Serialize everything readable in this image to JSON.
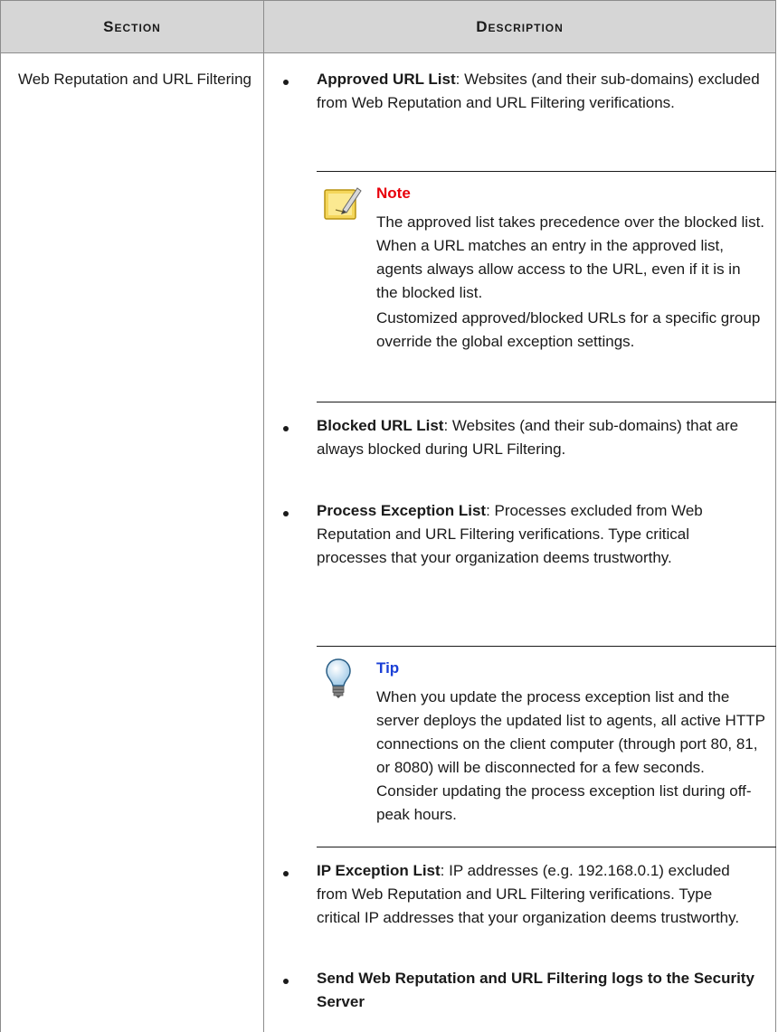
{
  "table": {
    "headers": {
      "section": "Section",
      "description": "Description"
    },
    "section_name": "Web Reputation and URL Filtering",
    "items": [
      {
        "term": "Approved URL List",
        "text": ": Websites (and their sub-domains) excluded from Web Reputation and URL Filtering verifications."
      },
      {
        "term": "Blocked URL List",
        "text": ": Websites (and their sub-domains) that are always blocked during URL Filtering."
      },
      {
        "term": "Process Exception List",
        "text": ": Processes excluded from Web Reputation and URL Filtering verifications. Type critical processes that your organization deems trustworthy."
      },
      {
        "term": "IP Exception List",
        "text": ": IP addresses (e.g. 192.168.0.1) excluded from Web Reputation and URL Filtering verifications. Type critical IP addresses that your organization deems trustworthy."
      },
      {
        "term": "Send Web Reputation and URL Filtering logs to the Security Server",
        "text": ""
      }
    ],
    "note": {
      "title": "Note",
      "color": "#e8000b",
      "paragraphs": [
        "The approved list takes precedence over the blocked list. When a URL matches an entry in the approved list, agents always allow access to the URL, even if it is in the blocked list.",
        "Customized approved/blocked URLs for a specific group override the global exception settings."
      ]
    },
    "tip": {
      "title": "Tip",
      "color": "#1a3fd6",
      "paragraphs": [
        "When you update the process exception list and the server deploys the updated list to agents, all active HTTP connections on the client computer (through port 80, 81, or 8080) will be disconnected for a few seconds. Consider updating the process exception list during off-peak hours."
      ]
    },
    "icons": {
      "note": "notepad-pencil-icon",
      "tip": "lightbulb-icon"
    }
  }
}
